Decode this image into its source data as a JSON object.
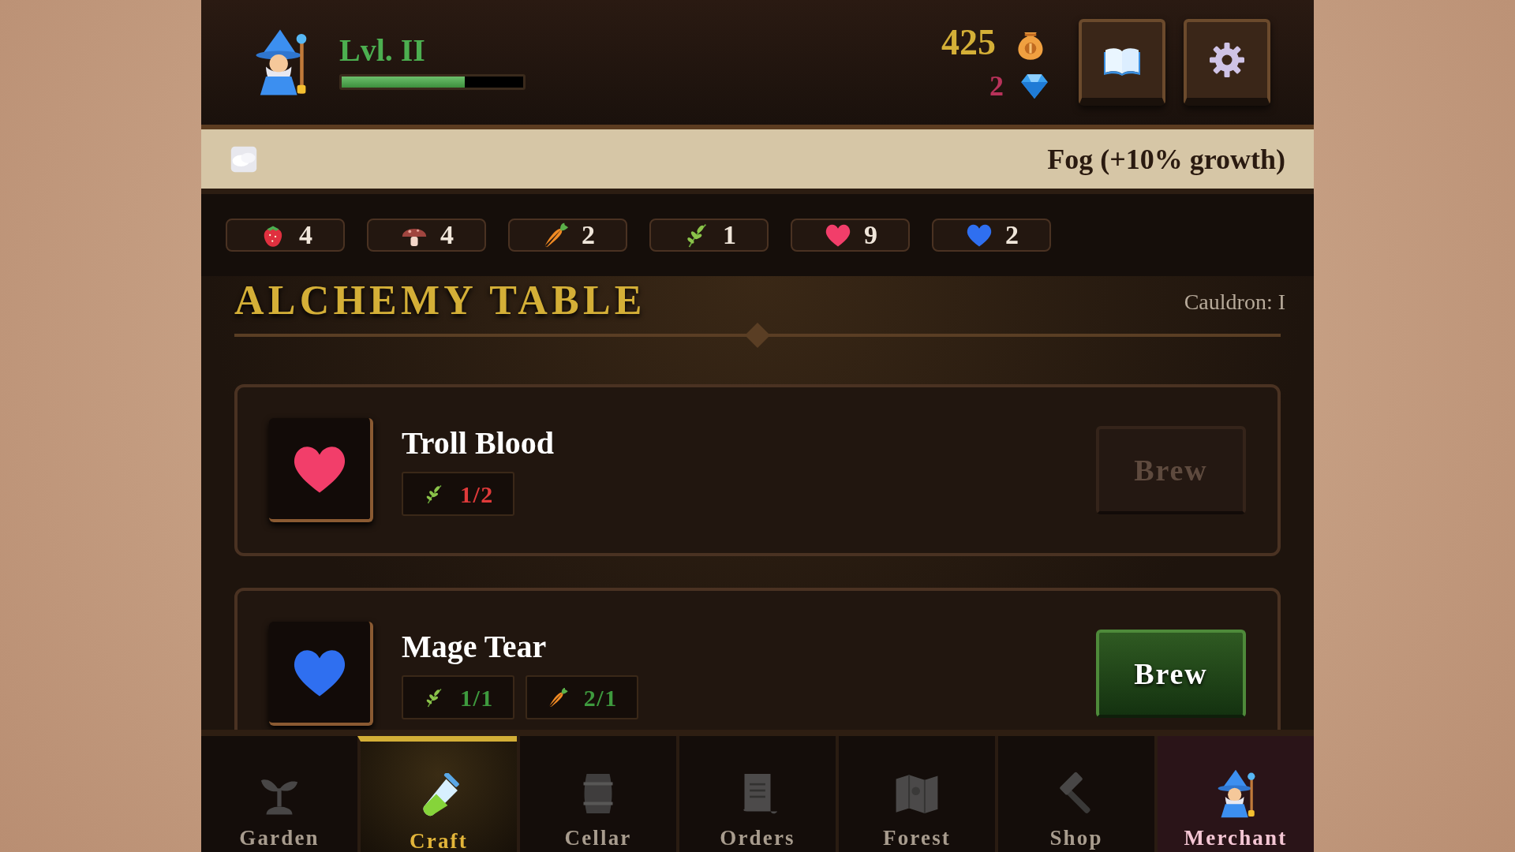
{
  "player": {
    "level_label": "Lvl. II",
    "xp": {
      "level": 0.68
    },
    "gold": "425",
    "gems": "2"
  },
  "weather": {
    "kind": "fog",
    "text": "Fog (+10% growth)"
  },
  "resources": [
    {
      "kind": "strawberry",
      "count": "4"
    },
    {
      "kind": "mushroom",
      "count": "4"
    },
    {
      "kind": "carrot",
      "count": "2"
    },
    {
      "kind": "herb",
      "count": "1"
    },
    {
      "kind": "red_heart",
      "count": "9"
    },
    {
      "kind": "blue_heart",
      "count": "2"
    }
  ],
  "section": {
    "title": "ALCHEMY TABLE",
    "cauldron": "Cauldron: I"
  },
  "recipes": [
    {
      "name": "Troll Blood",
      "kind": "red_heart",
      "ingredients": [
        {
          "kind": "herb",
          "amount": "1/2",
          "sufficient": false
        }
      ],
      "button": "Brew",
      "disabled": true
    },
    {
      "name": "Mage Tear",
      "kind": "blue_heart",
      "ingredients": [
        {
          "kind": "herb",
          "amount": "1/1",
          "sufficient": true
        },
        {
          "kind": "carrot",
          "amount": "2/1",
          "sufficient": true
        }
      ],
      "button": "Brew",
      "disabled": false
    }
  ],
  "nav": [
    {
      "label": "Garden",
      "kind": "sprout",
      "selected": false,
      "highlighted": false
    },
    {
      "label": "Craft",
      "kind": "testtube",
      "selected": true,
      "highlighted": false
    },
    {
      "label": "Cellar",
      "kind": "barrel",
      "selected": false,
      "highlighted": false
    },
    {
      "label": "Orders",
      "kind": "scroll",
      "selected": false,
      "highlighted": false
    },
    {
      "label": "Forest",
      "kind": "map",
      "selected": false,
      "highlighted": false
    },
    {
      "label": "Shop",
      "kind": "hammer",
      "selected": false,
      "highlighted": false
    },
    {
      "label": "Merchant",
      "kind": "wizard",
      "selected": false,
      "highlighted": true
    }
  ]
}
